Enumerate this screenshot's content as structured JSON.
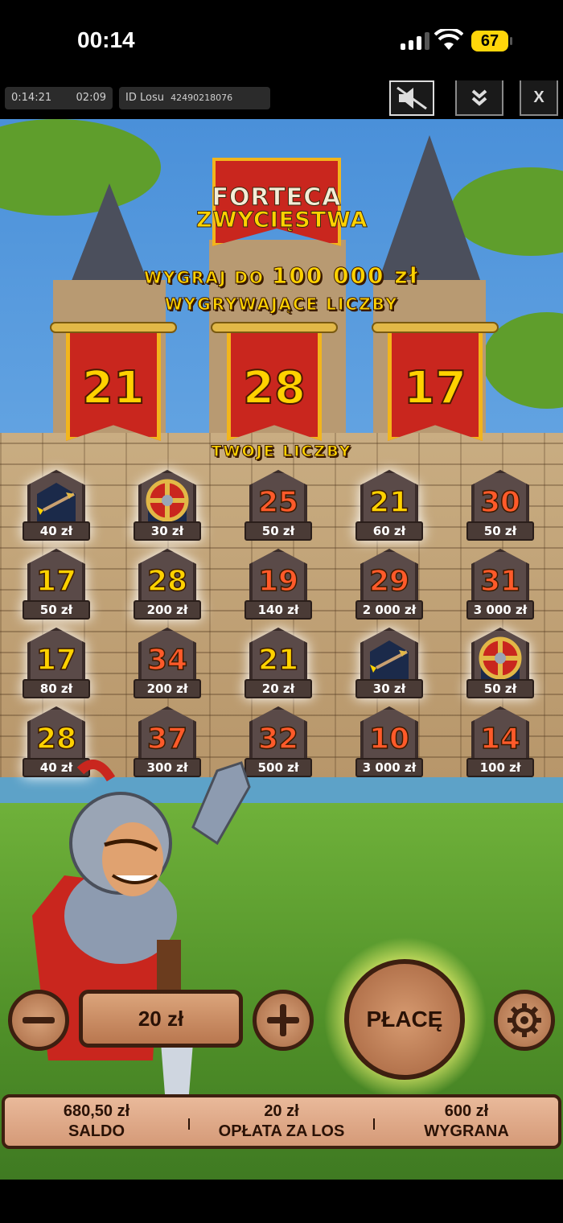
{
  "status_bar": {
    "time": "00:14",
    "battery": "67"
  },
  "toolbar": {
    "session_time": "0:14:21",
    "elapsed": "02:09",
    "ticket_label": "ID Losu",
    "ticket_id": "42490218076",
    "close_label": "X"
  },
  "game": {
    "logo_line1": "FORTECA",
    "logo_line2": "ZWYCIĘSTWA",
    "prize_prefix": "WYGRAJ DO",
    "prize_amount": "100 000 zł",
    "winning_label": "WYGRYWAJĄCE LICZBY",
    "winning_numbers": [
      "21",
      "28",
      "17"
    ],
    "your_label": "TWOJE LICZBY",
    "cells": [
      {
        "num": "",
        "prize": "40 zł",
        "symbol": "arrow-icon"
      },
      {
        "num": "",
        "prize": "30 zł",
        "symbol": "shield-icon"
      },
      {
        "num": "25",
        "prize": "50 zł"
      },
      {
        "num": "21",
        "prize": "60 zł"
      },
      {
        "num": "30",
        "prize": "50 zł"
      },
      {
        "num": "17",
        "prize": "50 zł"
      },
      {
        "num": "28",
        "prize": "200 zł"
      },
      {
        "num": "19",
        "prize": "140 zł"
      },
      {
        "num": "29",
        "prize": "2 000 zł"
      },
      {
        "num": "31",
        "prize": "3 000 zł"
      },
      {
        "num": "17",
        "prize": "80 zł"
      },
      {
        "num": "34",
        "prize": "200 zł"
      },
      {
        "num": "21",
        "prize": "20 zł"
      },
      {
        "num": "",
        "prize": "30 zł",
        "symbol": "arrow-icon"
      },
      {
        "num": "",
        "prize": "50 zł",
        "symbol": "shield-icon"
      },
      {
        "num": "28",
        "prize": "40 zł"
      },
      {
        "num": "37",
        "prize": "300 zł"
      },
      {
        "num": "32",
        "prize": "500 zł"
      },
      {
        "num": "10",
        "prize": "3 000 zł"
      },
      {
        "num": "14",
        "prize": "100 zł"
      }
    ]
  },
  "controls": {
    "bet_value": "20 zł",
    "play_label": "PŁACĘ"
  },
  "summary": {
    "balance_value": "680,50 zł",
    "balance_label": "SALDO",
    "fee_value": "20 zł",
    "fee_label": "OPŁATA ZA LOS",
    "win_value": "600 zł",
    "win_label": "WYGRANA"
  },
  "colors": {
    "gold": "#ffd200",
    "orange": "#ff5a2a",
    "banner_red": "#c9261e",
    "wood": "#b9774f"
  }
}
